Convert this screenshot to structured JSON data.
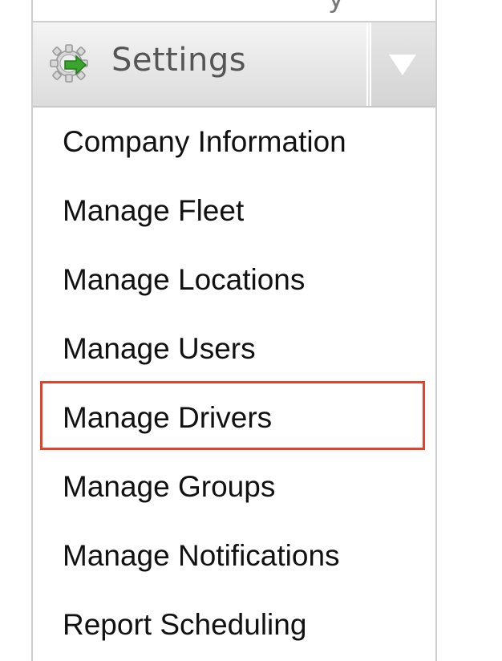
{
  "header": {
    "title": "Settings",
    "icon": "gear-icon",
    "dropdown_icon": "chevron-down-icon"
  },
  "menu": {
    "items": [
      {
        "label": "Company Information"
      },
      {
        "label": "Manage Fleet"
      },
      {
        "label": "Manage Locations"
      },
      {
        "label": "Manage Users"
      },
      {
        "label": "Manage Drivers",
        "highlighted": true
      },
      {
        "label": "Manage Groups"
      },
      {
        "label": "Manage Notifications"
      },
      {
        "label": "Report Scheduling"
      }
    ]
  },
  "colors": {
    "highlight_border": "#e0452b",
    "gear_arrow": "#3aa52c",
    "header_text": "#555555"
  }
}
